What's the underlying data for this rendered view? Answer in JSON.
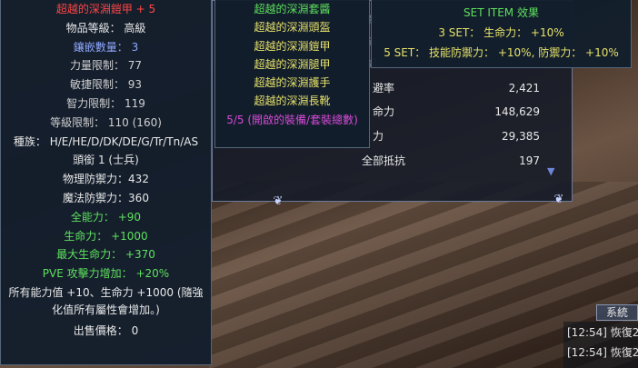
{
  "item": {
    "name": "超越的深淵鎧甲 + 5",
    "category": "物品等級： 高級",
    "sockets": "鑲嵌數量： 3",
    "str_req": "力量限制： 77",
    "dex_req": "敏捷限制： 93",
    "int_req": "智力限制： 119",
    "level_req": "等級限制： 110 (160)",
    "race": "種族： H/E/HE/D/DK/DE/G/Tr/Tn/AS",
    "title_req": "頭銜 1 (士兵)",
    "phys_def": "物理防禦力：432",
    "mag_def": "魔法防禦力：360",
    "all_stats": "全能力： +90",
    "hp": "生命力： +1000",
    "max_hp": "最大生命力： +370",
    "pve_atk": "PVE 攻擊力增加： +20%",
    "enhance_note": "所有能力值 +10、生命力 +1000 (隨強化值所有屬性會增加。)",
    "sell_price": "出售價格： 0"
  },
  "set_list": {
    "header": "超越的深淵套醬",
    "pieces": [
      "超越的深淵頭盔",
      "超越的深淵鎧甲",
      "超越的深淵腿甲",
      "超越的深淵護手",
      "超越的深淵長靴"
    ],
    "footer": "5/5 (開啟的裝備/套裝總數)"
  },
  "set_effect": {
    "header": "SET ITEM 效果",
    "set3": "3 SET： 生命力： +10%",
    "set5": "5 SET： 技能防禦力： +10%, 防禦力： +10%"
  },
  "stats": {
    "edge_glyphs": [
      "節",
      "去",
      "諾"
    ],
    "rows": [
      {
        "label": "避率",
        "value": "2,421"
      },
      {
        "label": "命力",
        "value": "148,629"
      },
      {
        "label": "力",
        "value": "29,385"
      },
      {
        "label": "全部抵抗",
        "value": "197"
      }
    ],
    "scroll_icon": "scroll-down-triangle"
  },
  "chat": {
    "tab_label": "系統",
    "lines": [
      "[12:54] 恢復2",
      "[12:54] 恢復2"
    ]
  }
}
